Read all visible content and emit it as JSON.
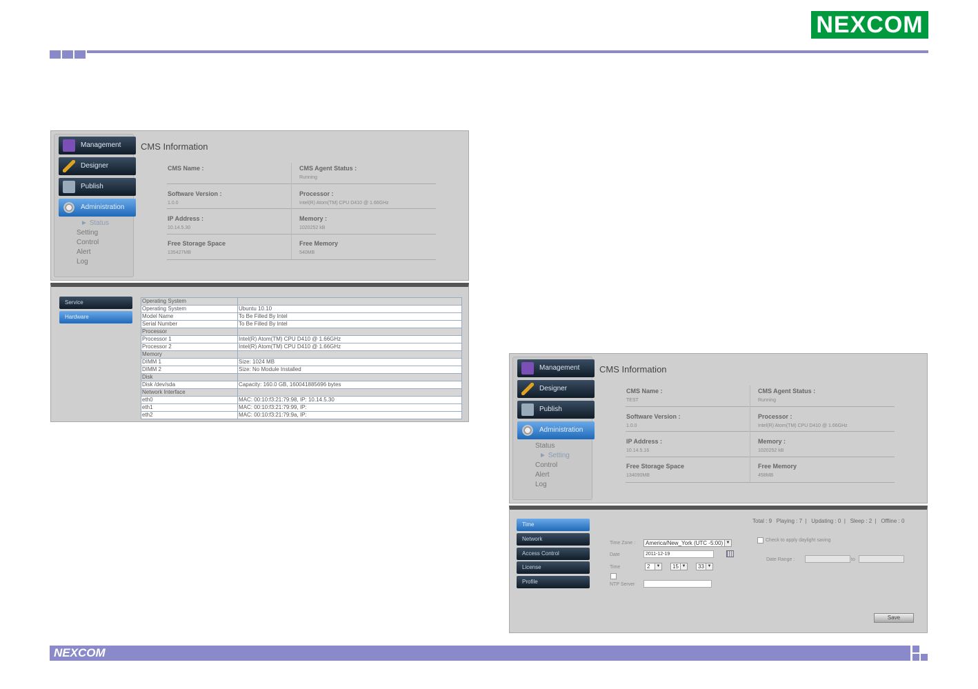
{
  "brand": {
    "logo_text": "NEXCOM",
    "footer_logo_text": "NEXCOM"
  },
  "nav": {
    "management": "Management",
    "designer": "Designer",
    "publish": "Publish",
    "administration": "Administration",
    "sub": [
      "Status",
      "Setting",
      "Control",
      "Alert",
      "Log"
    ]
  },
  "left": {
    "title": "CMS Information",
    "fields": [
      {
        "label": "CMS Name :",
        "value": ""
      },
      {
        "label": "CMS Agent Status :",
        "value": "Running"
      },
      {
        "label": "Software Version :",
        "value": "1.0.0"
      },
      {
        "label": "Processor :",
        "value": "Intel(R) Atom(TM) CPU D410 @ 1.66GHz"
      },
      {
        "label": "IP Address :",
        "value": "10.14.5.30"
      },
      {
        "label": "Memory :",
        "value": "1020252 kB"
      },
      {
        "label": "Free Storage Space",
        "value": "135427MB"
      },
      {
        "label": "Free Memory",
        "value": "540MB"
      }
    ],
    "side": [
      "Service",
      "Hardware"
    ],
    "hardware": [
      {
        "k": "Operating System",
        "v": "",
        "group": true
      },
      {
        "k": "Operating System",
        "v": "Ubuntu 10.10"
      },
      {
        "k": "Model Name",
        "v": "To Be Filled By Intel"
      },
      {
        "k": "Serial Number",
        "v": "To Be Filled By Intel"
      },
      {
        "k": "Processor",
        "v": "",
        "group": true
      },
      {
        "k": "Processor 1",
        "v": "Intel(R) Atom(TM) CPU D410 @ 1.66GHz"
      },
      {
        "k": "Processor 2",
        "v": "Intel(R) Atom(TM) CPU D410 @ 1.66GHz"
      },
      {
        "k": "Memory",
        "v": "",
        "group": true
      },
      {
        "k": "DIMM 1",
        "v": "Size: 1024 MB"
      },
      {
        "k": "DIMM 2",
        "v": "Size: No Module Installed"
      },
      {
        "k": "Disk",
        "v": "",
        "group": true
      },
      {
        "k": "Disk /dev/sda",
        "v": "Capacity: 160.0 GB, 160041885696 bytes"
      },
      {
        "k": "Network Interface",
        "v": "",
        "group": true
      },
      {
        "k": "eth0",
        "v": "MAC: 00:10:f3:21:79:98, IP: 10.14.5.30"
      },
      {
        "k": "eth1",
        "v": "MAC: 00:10:f3:21:79:99, IP:"
      },
      {
        "k": "eth2",
        "v": "MAC: 00:10:f3:21:79:9a, IP:"
      }
    ]
  },
  "right": {
    "title": "CMS Information",
    "fields": [
      {
        "label": "CMS Name :",
        "value": "TEST"
      },
      {
        "label": "CMS Agent Status :",
        "value": "Running"
      },
      {
        "label": "Software Version :",
        "value": "1.0.0"
      },
      {
        "label": "Processor :",
        "value": "Intel(R) Atom(TM) CPU D410 @ 1.66GHz"
      },
      {
        "label": "IP Address :",
        "value": "10.14.5.16"
      },
      {
        "label": "Memory :",
        "value": "1020252 kB"
      },
      {
        "label": "Free Storage Space",
        "value": "134090MB"
      },
      {
        "label": "Free Memory",
        "value": "458MB"
      }
    ],
    "side": [
      "Time",
      "Network",
      "Access Control",
      "License",
      "Profile"
    ],
    "status_bar": "Total : 9   Playing : 7  |   Updating : 0  |   Sleep : 2  |   Offline : 0",
    "time_zone_label": "Time Zone :",
    "time_zone_value": "America/New_York (UTC -5:00)",
    "date_label": "Date",
    "date_value": "2011-12-19",
    "time_label": "Time",
    "hour": "2",
    "minute": "15",
    "second": "33",
    "ntp_label": "NTP Server",
    "dst_label": "Check to apply daylight saving",
    "date_range_label": "Date Range :",
    "to_label": "to",
    "save": "Save"
  }
}
